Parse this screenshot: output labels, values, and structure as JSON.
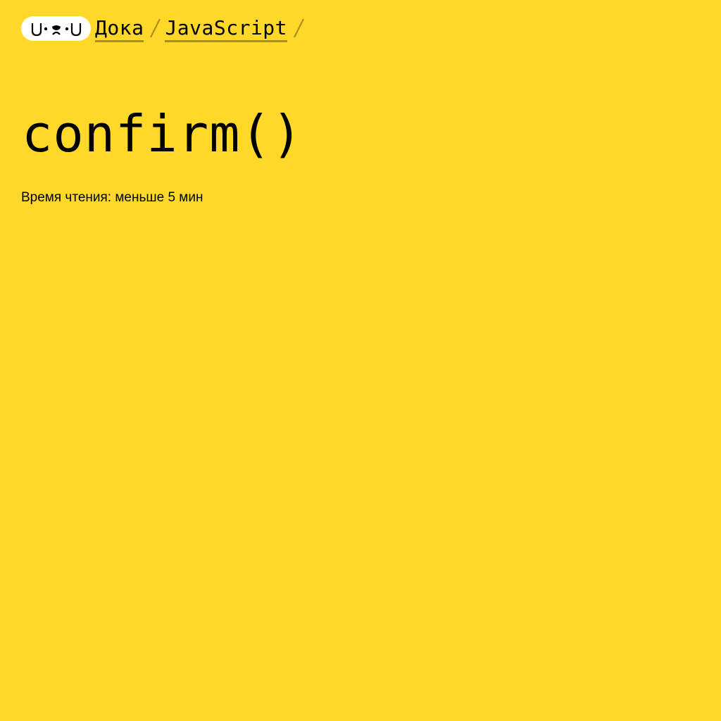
{
  "colors": {
    "background": "#FFD829",
    "logo_background": "#FFFFFF",
    "link_underline": "#A88E1C",
    "text": "#000000"
  },
  "logo": {
    "text": "U•ᴥ•U",
    "icon": "doka-dog-face-logo"
  },
  "breadcrumbs": [
    {
      "label": "Дока"
    },
    {
      "label": "JavaScript"
    }
  ],
  "separator_icon": "slash-separator-icon",
  "article": {
    "title": "confirm()",
    "reading_time": "Время чтения: меньше 5 мин"
  }
}
